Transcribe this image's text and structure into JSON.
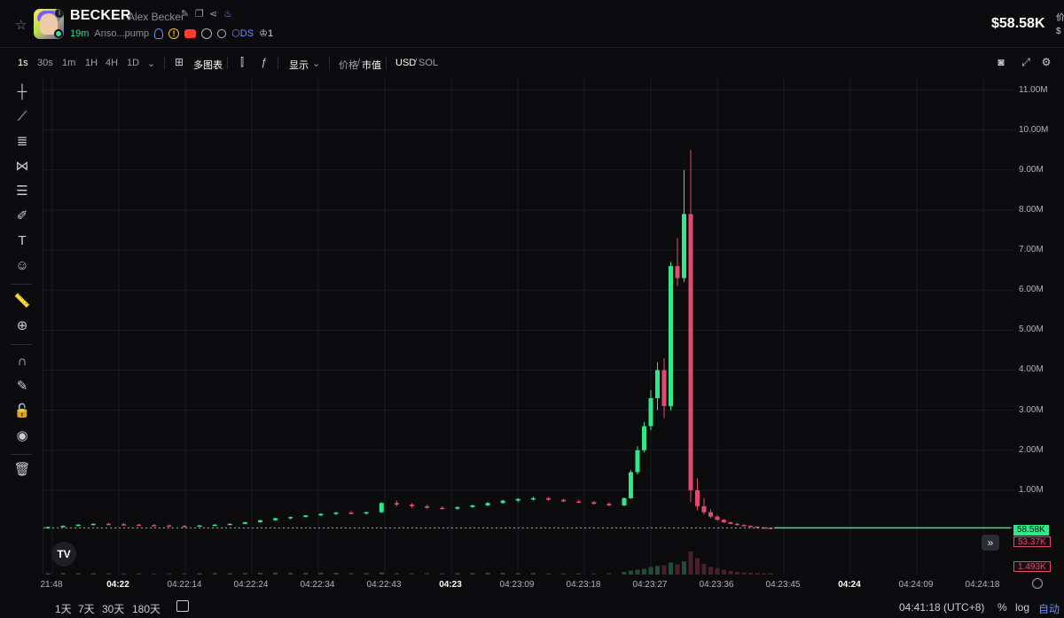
{
  "token": {
    "ticker": "BECKER",
    "name": "Alex Becker",
    "age": "19m",
    "creator": "Anso...pump",
    "tag_ds": "DS",
    "holders_badge": "1",
    "price": "$58.58K",
    "side_top": "价",
    "side_bottom": "$"
  },
  "toolbar": {
    "timeframes": [
      "1s",
      "30s",
      "1m",
      "1H",
      "4H",
      "1D"
    ],
    "active_timeframe": "1s",
    "multi_chart": "多图表",
    "display": "显示",
    "price_label": "价格",
    "mcap_label": "市值",
    "usd": "USD",
    "sol": "SOL"
  },
  "chart_data": {
    "type": "candlestick",
    "y_unit": "market cap (USD)",
    "y_ticks": [
      "1.00M",
      "2.00M",
      "3.00M",
      "4.00M",
      "5.00M",
      "6.00M",
      "7.00M",
      "8.00M",
      "9.00M",
      "10.00M",
      "11.00M"
    ],
    "ylim": [
      0,
      11300000
    ],
    "x_ticks": [
      {
        "label": "21:48",
        "bold": false
      },
      {
        "label": "04:22",
        "bold": true
      },
      {
        "label": "04:22:14",
        "bold": false
      },
      {
        "label": "04:22:24",
        "bold": false
      },
      {
        "label": "04:22:34",
        "bold": false
      },
      {
        "label": "04:22:43",
        "bold": false
      },
      {
        "label": "04:23",
        "bold": true
      },
      {
        "label": "04:23:09",
        "bold": false
      },
      {
        "label": "04:23:18",
        "bold": false
      },
      {
        "label": "04:23:27",
        "bold": false
      },
      {
        "label": "04:23:36",
        "bold": false
      },
      {
        "label": "04:23:45",
        "bold": false
      },
      {
        "label": "04:24",
        "bold": true
      },
      {
        "label": "04:24:09",
        "bold": false
      },
      {
        "label": "04:24:18",
        "bold": false
      }
    ],
    "current_mcap": "58.58K",
    "mcap_marker": "53.37K",
    "volume_marker": "1.493K",
    "candles": [
      {
        "o": 50000,
        "h": 90000,
        "l": 40000,
        "c": 80000
      },
      {
        "o": 80000,
        "h": 120000,
        "l": 70000,
        "c": 110000
      },
      {
        "o": 110000,
        "h": 150000,
        "l": 100000,
        "c": 140000
      },
      {
        "o": 140000,
        "h": 170000,
        "l": 120000,
        "c": 160000
      },
      {
        "o": 160000,
        "h": 190000,
        "l": 140000,
        "c": 150000
      },
      {
        "o": 150000,
        "h": 180000,
        "l": 130000,
        "c": 140000
      },
      {
        "o": 140000,
        "h": 160000,
        "l": 120000,
        "c": 130000
      },
      {
        "o": 130000,
        "h": 150000,
        "l": 110000,
        "c": 120000
      },
      {
        "o": 120000,
        "h": 140000,
        "l": 100000,
        "c": 110000
      },
      {
        "o": 110000,
        "h": 130000,
        "l": 90000,
        "c": 100000
      },
      {
        "o": 100000,
        "h": 130000,
        "l": 90000,
        "c": 120000
      },
      {
        "o": 120000,
        "h": 150000,
        "l": 110000,
        "c": 140000
      },
      {
        "o": 140000,
        "h": 170000,
        "l": 130000,
        "c": 160000
      },
      {
        "o": 160000,
        "h": 210000,
        "l": 150000,
        "c": 200000
      },
      {
        "o": 200000,
        "h": 260000,
        "l": 190000,
        "c": 250000
      },
      {
        "o": 250000,
        "h": 310000,
        "l": 240000,
        "c": 300000
      },
      {
        "o": 300000,
        "h": 340000,
        "l": 270000,
        "c": 330000
      },
      {
        "o": 330000,
        "h": 380000,
        "l": 320000,
        "c": 370000
      },
      {
        "o": 370000,
        "h": 420000,
        "l": 350000,
        "c": 410000
      },
      {
        "o": 410000,
        "h": 460000,
        "l": 380000,
        "c": 440000
      },
      {
        "o": 440000,
        "h": 480000,
        "l": 400000,
        "c": 420000
      },
      {
        "o": 420000,
        "h": 460000,
        "l": 390000,
        "c": 450000
      },
      {
        "o": 450000,
        "h": 700000,
        "l": 430000,
        "c": 680000
      },
      {
        "o": 680000,
        "h": 740000,
        "l": 600000,
        "c": 640000
      },
      {
        "o": 640000,
        "h": 680000,
        "l": 560000,
        "c": 600000
      },
      {
        "o": 600000,
        "h": 640000,
        "l": 540000,
        "c": 560000
      },
      {
        "o": 560000,
        "h": 600000,
        "l": 520000,
        "c": 540000
      },
      {
        "o": 540000,
        "h": 590000,
        "l": 510000,
        "c": 580000
      },
      {
        "o": 580000,
        "h": 640000,
        "l": 560000,
        "c": 620000
      },
      {
        "o": 620000,
        "h": 700000,
        "l": 600000,
        "c": 680000
      },
      {
        "o": 680000,
        "h": 760000,
        "l": 660000,
        "c": 740000
      },
      {
        "o": 740000,
        "h": 800000,
        "l": 700000,
        "c": 780000
      },
      {
        "o": 780000,
        "h": 840000,
        "l": 740000,
        "c": 800000
      },
      {
        "o": 800000,
        "h": 830000,
        "l": 740000,
        "c": 760000
      },
      {
        "o": 760000,
        "h": 790000,
        "l": 700000,
        "c": 720000
      },
      {
        "o": 720000,
        "h": 760000,
        "l": 680000,
        "c": 700000
      },
      {
        "o": 700000,
        "h": 730000,
        "l": 640000,
        "c": 660000
      },
      {
        "o": 660000,
        "h": 700000,
        "l": 600000,
        "c": 620000
      },
      {
        "o": 620000,
        "h": 820000,
        "l": 600000,
        "c": 800000
      },
      {
        "o": 800000,
        "h": 1500000,
        "l": 780000,
        "c": 1450000
      },
      {
        "o": 1450000,
        "h": 2100000,
        "l": 1400000,
        "c": 2000000
      },
      {
        "o": 2000000,
        "h": 2700000,
        "l": 1950000,
        "c": 2600000
      },
      {
        "o": 2600000,
        "h": 3500000,
        "l": 2500000,
        "c": 3300000
      },
      {
        "o": 3300000,
        "h": 4200000,
        "l": 3000000,
        "c": 4000000
      },
      {
        "o": 4000000,
        "h": 4300000,
        "l": 2800000,
        "c": 3100000
      },
      {
        "o": 3100000,
        "h": 6700000,
        "l": 3000000,
        "c": 6600000
      },
      {
        "o": 6600000,
        "h": 7300000,
        "l": 6100000,
        "c": 6300000
      },
      {
        "o": 6300000,
        "h": 9000000,
        "l": 6200000,
        "c": 7900000
      },
      {
        "o": 7900000,
        "h": 9500000,
        "l": 700000,
        "c": 1000000
      },
      {
        "o": 1000000,
        "h": 1300000,
        "l": 500000,
        "c": 600000
      },
      {
        "o": 600000,
        "h": 800000,
        "l": 400000,
        "c": 450000
      },
      {
        "o": 450000,
        "h": 520000,
        "l": 300000,
        "c": 340000
      },
      {
        "o": 340000,
        "h": 380000,
        "l": 240000,
        "c": 260000
      },
      {
        "o": 260000,
        "h": 280000,
        "l": 180000,
        "c": 200000
      },
      {
        "o": 200000,
        "h": 220000,
        "l": 150000,
        "c": 160000
      },
      {
        "o": 160000,
        "h": 180000,
        "l": 120000,
        "c": 130000
      },
      {
        "o": 130000,
        "h": 150000,
        "l": 100000,
        "c": 110000
      },
      {
        "o": 110000,
        "h": 120000,
        "l": 80000,
        "c": 90000
      },
      {
        "o": 90000,
        "h": 100000,
        "l": 65000,
        "c": 70000
      },
      {
        "o": 70000,
        "h": 80000,
        "l": 55000,
        "c": 60000
      },
      {
        "o": 60000,
        "h": 70000,
        "l": 52000,
        "c": 58580
      }
    ],
    "volume": [
      2,
      3,
      2,
      2,
      3,
      2,
      2,
      1,
      2,
      2,
      2,
      3,
      2,
      3,
      4,
      5,
      4,
      4,
      5,
      4,
      4,
      3,
      6,
      4,
      3,
      3,
      2,
      3,
      3,
      4,
      4,
      3,
      3,
      2,
      2,
      2,
      2,
      3,
      8,
      14,
      18,
      22,
      30,
      35,
      38,
      50,
      42,
      55,
      100,
      70,
      45,
      30,
      25,
      18,
      12,
      8,
      5,
      4,
      3,
      2,
      2
    ],
    "grid": true,
    "current_price_line": true
  },
  "footer": {
    "ranges": [
      "1天",
      "7天",
      "30天",
      "180天"
    ],
    "time": "04:41:18 (UTC+8)",
    "percent": "%",
    "log": "log",
    "auto": "自动"
  },
  "colors": {
    "up": "#2ee88a",
    "down": "#e34a6f",
    "accent": "#6b8cff",
    "background": "#0b0b0e",
    "grid": "#1a1b20"
  }
}
